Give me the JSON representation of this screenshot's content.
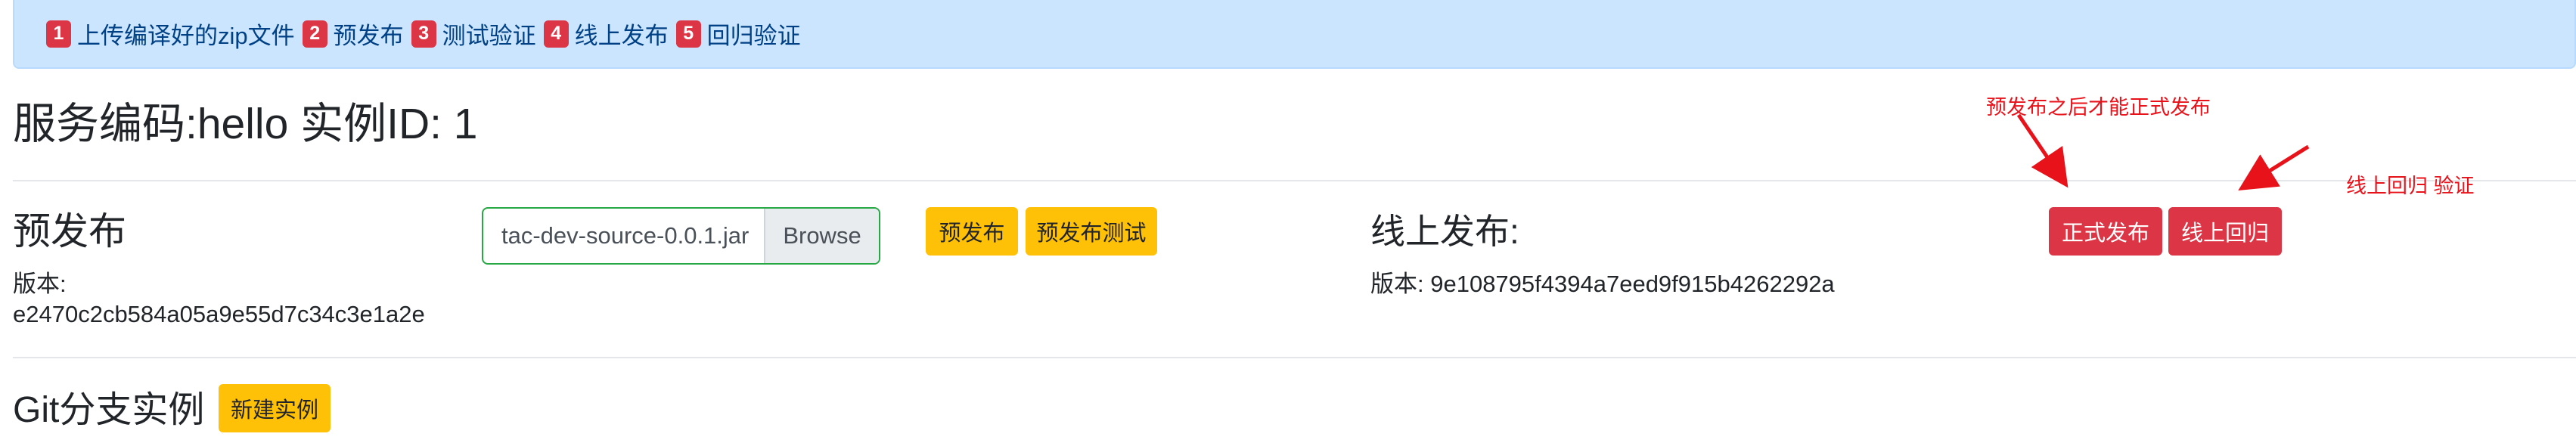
{
  "steps": [
    {
      "num": "1",
      "label": "上传编译好的zip文件"
    },
    {
      "num": "2",
      "label": "预发布"
    },
    {
      "num": "3",
      "label": "测试验证"
    },
    {
      "num": "4",
      "label": "线上发布"
    },
    {
      "num": "5",
      "label": "回归验证"
    }
  ],
  "page_title": "服务编码:hello 实例ID: 1",
  "prepublish": {
    "title": "预发布",
    "version_label": "版本:",
    "version_value": "e2470c2cb584a05a9e55d7c34c3e1a2e",
    "file_name": "tac-dev-source-0.0.1.jar",
    "browse_label": "Browse",
    "prepublish_button": "预发布",
    "prepublish_test_button": "预发布测试"
  },
  "online": {
    "title": "线上发布:",
    "version_text": "版本: 9e108795f4394a7eed9f915b4262292a",
    "publish_button": "正式发布",
    "regression_button": "线上回归"
  },
  "git": {
    "title": "Git分支实例",
    "new_instance_button": "新建实例"
  },
  "annotations": {
    "note_publish": "预发布之后才能正式发布",
    "note_regression": "线上回归 验证",
    "color": "#e8121b"
  },
  "colors": {
    "alert_bg": "#cce5ff",
    "warning": "#ffc107",
    "danger": "#dc3545",
    "success_border": "#28a745"
  }
}
